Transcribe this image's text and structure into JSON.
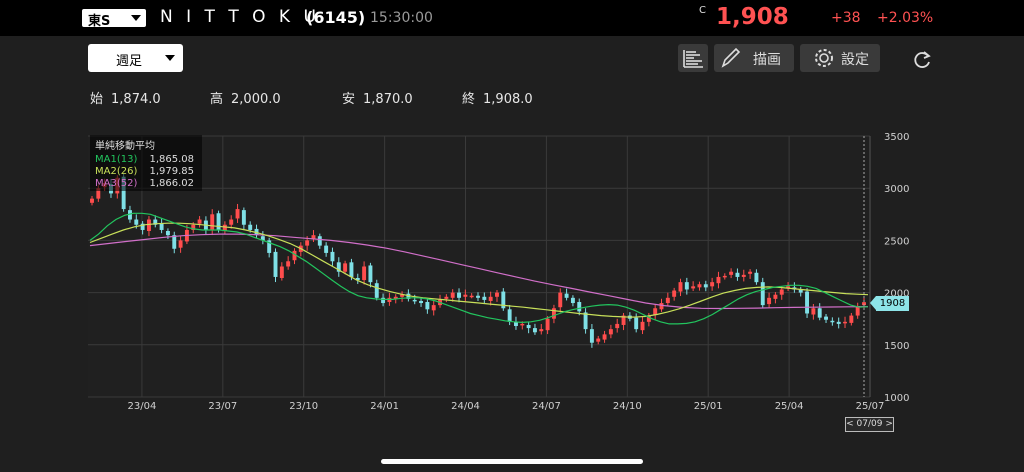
{
  "header": {
    "market": "東S",
    "title": "N I T T O K U",
    "code": "(6145)",
    "time": "15:30:00",
    "mark": "C",
    "price": "1,908",
    "change": "+38",
    "change_pct": "+2.03%"
  },
  "toolbar": {
    "period": "週足",
    "draw_label": "描画",
    "settings_label": "設定"
  },
  "ohlc": {
    "open_label": "始",
    "open": "1,874.0",
    "high_label": "高",
    "high": "2,000.0",
    "low_label": "安",
    "low": "1,870.0",
    "close_label": "終",
    "close": "1,908.0"
  },
  "legend": {
    "title": "単純移動平均",
    "ma1_name": "MA1(13)",
    "ma1_value": "1,865.08",
    "ma2_name": "MA2(26)",
    "ma2_value": "1,979.85",
    "ma3_name": "MA3(52)",
    "ma3_value": "1,866.02"
  },
  "last_price_tag": "1908",
  "crosshair_date": "< 07/09 >",
  "colors": {
    "up": "#ff4d4d",
    "down": "#7fe0e6",
    "ma1": "#22c55e",
    "ma2": "#c8e05a",
    "ma3": "#d16fc9",
    "background": "#1f1f1f",
    "grid": "#3a3a3a"
  },
  "icons": [
    "chevron-down-icon",
    "bar-list-icon",
    "pencil-icon",
    "gear-icon",
    "refresh-icon"
  ],
  "chart_data": {
    "type": "candlestick",
    "ylim": [
      1000,
      3500
    ],
    "yticks": [
      "3500",
      "3000",
      "2500",
      "2000",
      "1500",
      "1000"
    ],
    "yvalues": [
      3500,
      3000,
      2500,
      2000,
      1500,
      1000
    ],
    "xticks": [
      "23/04",
      "23/07",
      "23/10",
      "24/01",
      "24/04",
      "24/07",
      "24/10",
      "25/01",
      "25/04",
      "25/07"
    ],
    "x_start": "2023-02",
    "x_end": "2025-07",
    "closes": [
      2900,
      3000,
      3050,
      2950,
      3100,
      2800,
      2700,
      2650,
      2600,
      2700,
      2650,
      2600,
      2550,
      2420,
      2500,
      2600,
      2650,
      2700,
      2600,
      2750,
      2600,
      2650,
      2700,
      2800,
      2650,
      2600,
      2550,
      2500,
      2380,
      2150,
      2250,
      2300,
      2400,
      2450,
      2500,
      2550,
      2450,
      2380,
      2300,
      2200,
      2280,
      2150,
      2120,
      2250,
      2100,
      1950,
      1900,
      1950,
      1960,
      1980,
      1940,
      1920,
      1900,
      1840,
      1880,
      1930,
      1960,
      2000,
      1950,
      1980,
      1970,
      1950,
      1930,
      1960,
      2000,
      1850,
      1720,
      1680,
      1700,
      1660,
      1620,
      1650,
      1750,
      1850,
      2000,
      1950,
      1900,
      1820,
      1650,
      1520,
      1560,
      1600,
      1650,
      1700,
      1780,
      1750,
      1650,
      1720,
      1780,
      1850,
      1900,
      1950,
      2020,
      2100,
      2030,
      2060,
      2080,
      2050,
      2100,
      2150,
      2160,
      2200,
      2150,
      2170,
      2200,
      2100,
      1880,
      1950,
      1980,
      2030,
      2060,
      2030,
      2000,
      1800,
      1850,
      1760,
      1740,
      1720,
      1700,
      1720,
      1780,
      1870,
      1908
    ],
    "ma1": [
      2500,
      2560,
      2640,
      2700,
      2740,
      2760,
      2760,
      2750,
      2720,
      2690,
      2660,
      2630,
      2610,
      2600,
      2600,
      2600,
      2590,
      2580,
      2560,
      2530,
      2500,
      2470,
      2440,
      2400,
      2350,
      2300,
      2240,
      2180,
      2120,
      2060,
      2010,
      1970,
      1950,
      1940,
      1935,
      1935,
      1945,
      1950,
      1950,
      1940,
      1920,
      1890,
      1860,
      1830,
      1800,
      1780,
      1760,
      1745,
      1730,
      1720,
      1715,
      1720,
      1735,
      1760,
      1790,
      1820,
      1840,
      1855,
      1870,
      1880,
      1885,
      1880,
      1860,
      1830,
      1790,
      1750,
      1720,
      1700,
      1700,
      1705,
      1720,
      1750,
      1790,
      1840,
      1890,
      1940,
      1980,
      2010,
      2030,
      2050,
      2060,
      2070,
      2070,
      2060,
      2040,
      2000,
      1960,
      1920,
      1880,
      1860,
      1865
    ],
    "ma2": [
      2480,
      2520,
      2560,
      2600,
      2630,
      2650,
      2660,
      2665,
      2665,
      2660,
      2650,
      2640,
      2630,
      2620,
      2600,
      2575,
      2545,
      2510,
      2470,
      2420,
      2360,
      2300,
      2240,
      2180,
      2120,
      2075,
      2040,
      2010,
      1985,
      1965,
      1950,
      1940,
      1930,
      1920,
      1910,
      1900,
      1890,
      1880,
      1870,
      1860,
      1848,
      1836,
      1824,
      1812,
      1800,
      1790,
      1780,
      1772,
      1767,
      1765,
      1772,
      1790,
      1815,
      1845,
      1880,
      1920,
      1960,
      1995,
      2020,
      2040,
      2050,
      2055,
      2050,
      2040,
      2030,
      2020,
      2010,
      2000,
      1990,
      1985,
      1980
    ],
    "ma3": [
      2450,
      2470,
      2490,
      2510,
      2530,
      2545,
      2555,
      2560,
      2560,
      2555,
      2545,
      2530,
      2515,
      2500,
      2480,
      2455,
      2425,
      2390,
      2350,
      2310,
      2270,
      2230,
      2190,
      2150,
      2110,
      2075,
      2040,
      2005,
      1970,
      1935,
      1900,
      1875,
      1858,
      1850,
      1848,
      1850,
      1852,
      1855,
      1858,
      1860,
      1862,
      1864,
      1866
    ]
  }
}
